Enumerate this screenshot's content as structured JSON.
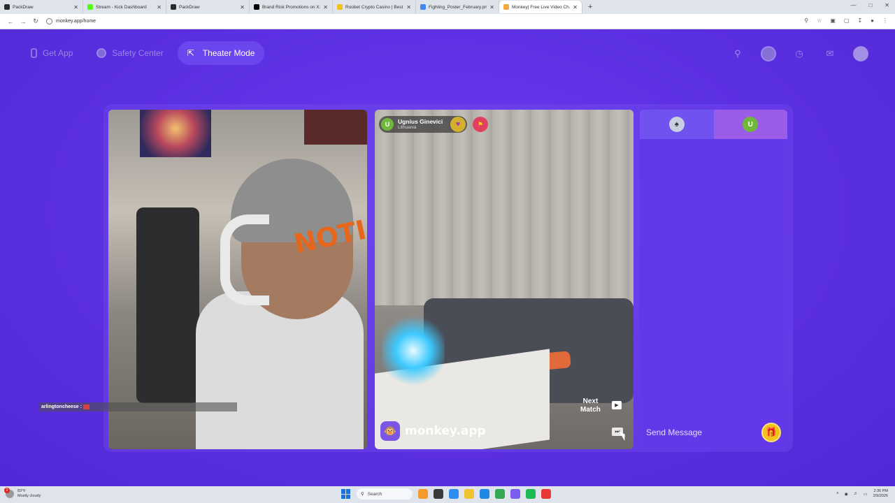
{
  "browser": {
    "tabs": [
      {
        "title": "PackDraw",
        "color": "#2a2a2a",
        "active": false
      },
      {
        "title": "Stream - Kick Dashboard",
        "color": "#53fc18",
        "active": false
      },
      {
        "title": "PackDraw",
        "color": "#2a2a2a",
        "active": false
      },
      {
        "title": "Brand Risk Promotions on X: \"...",
        "color": "#000000",
        "active": false
      },
      {
        "title": "Roobet Crypto Casino | Best Bit...",
        "color": "#f2c21b",
        "active": false
      },
      {
        "title": "Fighting_Poster_February.png (...",
        "color": "#4285f4",
        "active": false
      },
      {
        "title": "Monkey| Free Live Video Ch...",
        "color": "#f2a93b",
        "active": true
      }
    ],
    "new_tab": "+",
    "url": "monkey.app/home"
  },
  "topnav": {
    "get_app": "Get App",
    "safety_center": "Safety Center",
    "theater_mode": "Theater Mode"
  },
  "left_video": {
    "chat_overlay_name": "arlingtoncheese :",
    "beanie_text": "NOTI"
  },
  "right_video": {
    "peer_initial": "U",
    "peer_name": "Ugnius Ginevici",
    "peer_country": "Lithuania",
    "watermark": "monkey.app",
    "next_match_line1": "Next",
    "next_match_line2": "Match"
  },
  "chat": {
    "tab2_initial": "U",
    "send_placeholder": "Send Message"
  },
  "taskbar": {
    "weather_temp": "83°F",
    "weather_desc": "Mostly cloudy",
    "weather_badge": "2",
    "search_label": "Search",
    "time": "2:36 PM",
    "date": "2/9/2026"
  },
  "colors": {
    "app_bg": "#5a2fe0",
    "chat_panel": "#6238e8",
    "theater_pill": "#6b45ee",
    "gift": "#f2c21b"
  },
  "icons": [
    "phone-icon",
    "shield-icon",
    "expand-icon",
    "search-icon",
    "profile-avatar-icon",
    "history-icon",
    "messages-icon",
    "monkey-avatar-icon",
    "heart-icon",
    "flag-icon",
    "gift-icon",
    "play-icon",
    "skip-icon"
  ]
}
